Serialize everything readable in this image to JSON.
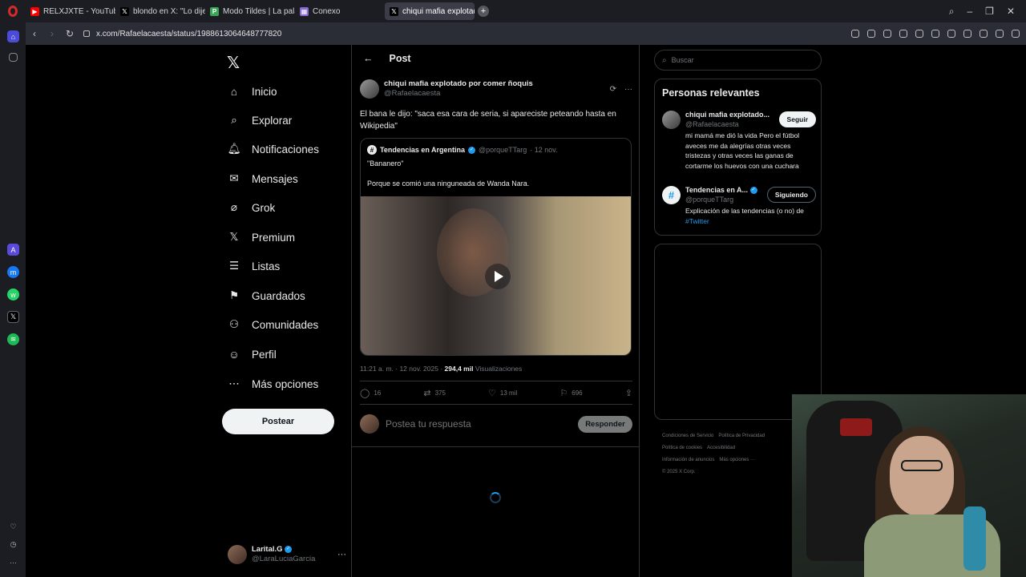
{
  "browser": {
    "tabs": [
      {
        "title": "RELXJXTE - YouTube",
        "icon": "youtube-icon",
        "color": "#ff0000",
        "glyph": "▶",
        "active": false
      },
      {
        "title": "blondo en X: \"Lo dije adiv",
        "icon": "x-icon",
        "color": "#000000",
        "glyph": "𝕏",
        "active": false
      },
      {
        "title": "Modo Tildes | La palabra del",
        "icon": "p-icon",
        "color": "#3aa655",
        "glyph": "P",
        "active": false
      },
      {
        "title": "Conexo",
        "icon": "grid-icon",
        "color": "#8a6bd1",
        "glyph": "▦",
        "active": false
      },
      {
        "title": "chiqui mafia explotado por",
        "icon": "x-icon",
        "color": "#000000",
        "glyph": "𝕏",
        "active": true
      }
    ],
    "url": "x.com/Rafaelacaesta/status/1988613064648777820"
  },
  "nav": {
    "items": [
      {
        "label": "Inicio",
        "icon": "home-icon",
        "glyph": "⌂"
      },
      {
        "label": "Explorar",
        "icon": "search-icon",
        "glyph": "⌕"
      },
      {
        "label": "Notificaciones",
        "icon": "bell-icon",
        "glyph": "♫"
      },
      {
        "label": "Mensajes",
        "icon": "mail-icon",
        "glyph": "✉"
      },
      {
        "label": "Grok",
        "icon": "grok-icon",
        "glyph": "⌀"
      },
      {
        "label": "Premium",
        "icon": "x-premium-icon",
        "glyph": "𝕏"
      },
      {
        "label": "Listas",
        "icon": "list-icon",
        "glyph": "☰"
      },
      {
        "label": "Guardados",
        "icon": "bookmark-icon",
        "glyph": "⚑"
      },
      {
        "label": "Comunidades",
        "icon": "communities-icon",
        "glyph": "⚇"
      },
      {
        "label": "Perfil",
        "icon": "profile-icon",
        "glyph": "☺"
      },
      {
        "label": "Más opciones",
        "icon": "more-circle-icon",
        "glyph": "⋯"
      }
    ],
    "post_button": "Postear",
    "profile": {
      "name": "Larital.G",
      "handle": "@LaraLuciaGarcia"
    }
  },
  "post": {
    "header": "Post",
    "author_name": "chiqui mafia explotado por comer ñoquis",
    "author_handle": "@Rafaelacaesta",
    "text": "El bana le dijo: \"saca esa cara de seria, si apareciste peteando hasta en Wikipedia\"",
    "quote": {
      "name": "Tendencias en Argentina",
      "handle": "@porqueTTarg",
      "date": "· 12 nov.",
      "line1": "\"Bananero\"",
      "line2": "Porque se comió una ninguneada de Wanda Nara."
    },
    "time": "11:21 a. m. · 12 nov. 2025 ·",
    "views": "294,4 mil",
    "views_label": "Visualizaciones",
    "stats": {
      "replies": "16",
      "reposts": "375",
      "likes": "13 mil",
      "bookmarks": "696"
    },
    "reply_placeholder": "Postea tu respuesta",
    "reply_button": "Responder"
  },
  "right": {
    "search_placeholder": "Buscar",
    "relevant_title": "Personas relevantes",
    "people": [
      {
        "name": "chiqui mafia explotado...",
        "handle": "@Rafaelacaesta",
        "button": "Seguir",
        "bio": "mi mamá me dió la vida Pero el fútbol aveces me da alegrías otras veces tristezas y otras veces las ganas de cortarme los huevos con una cuchara",
        "bio_link": ""
      },
      {
        "name": "Tendencias en A...",
        "handle": "@porqueTTarg",
        "button": "Siguiendo",
        "bio": "Explicación de las tendencias (o no) de ",
        "bio_link": "#Twitter"
      }
    ],
    "footer": [
      "Condiciones de Servicio",
      "Política de Privacidad",
      "Política de cookies",
      "Accesibilidad",
      "Información de anuncios",
      "Más opciones ···",
      "© 2025 X Corp."
    ]
  }
}
